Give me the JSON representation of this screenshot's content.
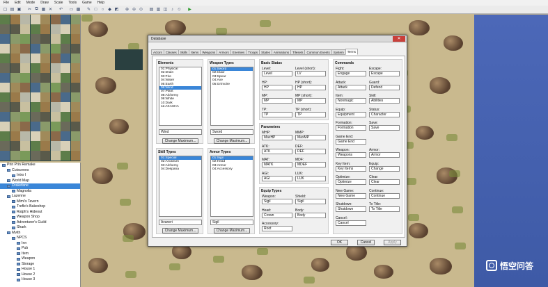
{
  "menubar": [
    "File",
    "Edit",
    "Mode",
    "Draw",
    "Scale",
    "Tools",
    "Game",
    "Help"
  ],
  "tree": [
    {
      "label": "Prin Prin Remake",
      "indent": 0,
      "selected": false
    },
    {
      "label": "Cutscenes",
      "indent": 1,
      "selected": false
    },
    {
      "label": "Intro I",
      "indent": 2,
      "selected": false
    },
    {
      "label": "World Map",
      "indent": 1,
      "selected": false
    },
    {
      "label": "Drakefane",
      "indent": 1,
      "selected": true
    },
    {
      "label": "Magnolia",
      "indent": 2,
      "selected": false
    },
    {
      "label": "Lazenne",
      "indent": 1,
      "selected": false
    },
    {
      "label": "Mimi's Tavern",
      "indent": 2,
      "selected": false
    },
    {
      "label": "Trefle's Bakeshop",
      "indent": 2,
      "selected": false
    },
    {
      "label": "Ralph's Hideout",
      "indent": 2,
      "selected": false
    },
    {
      "label": "Weapon Shop",
      "indent": 2,
      "selected": false
    },
    {
      "label": "Adventurer's Guild",
      "indent": 2,
      "selected": false
    },
    {
      "label": "Shark",
      "indent": 2,
      "selected": false
    },
    {
      "label": "Mvith",
      "indent": 1,
      "selected": false
    },
    {
      "label": "NPCS",
      "indent": 2,
      "selected": false
    },
    {
      "label": "Inn",
      "indent": 3,
      "selected": false
    },
    {
      "label": "Pub",
      "indent": 3,
      "selected": false
    },
    {
      "label": "Item",
      "indent": 3,
      "selected": false
    },
    {
      "label": "Weapon",
      "indent": 3,
      "selected": false
    },
    {
      "label": "Storage",
      "indent": 3,
      "selected": false
    },
    {
      "label": "House 1",
      "indent": 3,
      "selected": false
    },
    {
      "label": "House 2",
      "indent": 3,
      "selected": false
    },
    {
      "label": "House 3",
      "indent": 3,
      "selected": false
    }
  ],
  "dialog": {
    "title": "Database",
    "close_glyph": "✕",
    "tabs": [
      "Actors",
      "Classes",
      "Skills",
      "Items",
      "Weapons",
      "Armors",
      "Enemies",
      "Troops",
      "States",
      "Animations",
      "Tilesets",
      "Common Events",
      "System",
      "Terms"
    ],
    "active_tab": "Terms",
    "elements": {
      "title": "Elements",
      "items": [
        "01:Physical",
        "02:Drain",
        "03:Fire",
        "04:Water",
        "05:Earth",
        "06:Wind",
        "07:Plant",
        "08:Alchemy",
        "09:White",
        "10:Dark",
        "11:AKASHA"
      ],
      "selected": 5,
      "name": "Wind",
      "btn": "Change Maximum..."
    },
    "weapon_types": {
      "title": "Weapon Types",
      "items": [
        "01:Sword",
        "02:Claw",
        "03:Spear",
        "04:Axe",
        "05:Grimoire"
      ],
      "selected": 0,
      "name": "Sword",
      "btn": "Change Maximum..."
    },
    "skill_types": {
      "title": "Skill Types",
      "items": [
        "01:Special",
        "02:Arcanum",
        "03:Alchemy",
        "04:Despana"
      ],
      "selected": 0,
      "name": "Avaneri",
      "btn": "Change Maximum..."
    },
    "armor_types": {
      "title": "Armor Types",
      "items": [
        "01:Sigil",
        "02:Head",
        "03:Armor",
        "04:Accessory"
      ],
      "selected": 0,
      "name": "Sigil",
      "btn": "Change Maximum..."
    },
    "basic_status": {
      "title": "Basic Status",
      "fields": [
        {
          "l1": "Level:",
          "v1": "Level",
          "l2": "Level (short):",
          "v2": "LV"
        },
        {
          "l1": "HP:",
          "v1": "HP",
          "l2": "HP (short):",
          "v2": "HP"
        },
        {
          "l1": "MP:",
          "v1": "MP",
          "l2": "MP (short):",
          "v2": "MP"
        },
        {
          "l1": "TP:",
          "v1": "TP",
          "l2": "TP (short):",
          "v2": "TP"
        }
      ]
    },
    "parameters": {
      "title": "Parameters",
      "fields": [
        {
          "l1": "MHP:",
          "v1": "MaxHP",
          "l2": "MMP:",
          "v2": "MaxMP"
        },
        {
          "l1": "ATK:",
          "v1": "ATK",
          "l2": "DEF:",
          "v2": "DEF"
        },
        {
          "l1": "MAT:",
          "v1": "MATK",
          "l2": "MDF:",
          "v2": "MDEF"
        },
        {
          "l1": "AGI:",
          "v1": "AGI",
          "l2": "LUK:",
          "v2": "LUK"
        }
      ]
    },
    "equip_types": {
      "title": "Equip Types",
      "fields": [
        {
          "l1": "Weapon:",
          "v1": "Sigil",
          "l2": "Shield:",
          "v2": "Sigil"
        },
        {
          "l1": "Head:",
          "v1": "Crown",
          "l2": "Body:",
          "v2": "Body"
        },
        {
          "l1": "Accessory:",
          "v1": "Root",
          "l2": "",
          "v2": ""
        }
      ]
    },
    "commands": {
      "title": "Commands",
      "fields": [
        {
          "l1": "Fight:",
          "v1": "Engage",
          "l2": "Escape:",
          "v2": "Escape"
        },
        {
          "l1": "Attack:",
          "v1": "Attack",
          "l2": "Guard:",
          "v2": "Defend"
        },
        {
          "l1": "Item:",
          "v1": "Nonmagic",
          "l2": "Skill:",
          "v2": "Abilities"
        },
        {
          "l1": "Equip:",
          "v1": "Equipment",
          "l2": "Status:",
          "v2": "Character"
        },
        {
          "l1": "Formation:",
          "v1": "Formation",
          "l2": "Save:",
          "v2": "Save"
        },
        {
          "l1": "Game End:",
          "v1": "Game End",
          "l2": "",
          "v2": ""
        },
        {
          "l1": "Weapon:",
          "v1": "Weapons",
          "l2": "Armor:",
          "v2": "Armor"
        },
        {
          "l1": "Key Item:",
          "v1": "Key Items",
          "l2": "Equip:",
          "v2": "Change"
        },
        {
          "l1": "Optimize:",
          "v1": "Optimize",
          "l2": "Clear:",
          "v2": "Clear"
        },
        {
          "l1": "New Game:",
          "v1": "New Game",
          "l2": "Continue:",
          "v2": "Continue"
        },
        {
          "l1": "Shutdown:",
          "v1": "Shutdown",
          "l2": "To Title:",
          "v2": "To Title"
        },
        {
          "l1": "Cancel:",
          "v1": "Cancel",
          "l2": "",
          "v2": ""
        }
      ]
    },
    "buttons": {
      "ok": "OK",
      "cancel": "Cancel",
      "apply": "Apply"
    }
  },
  "watermark": {
    "text": "悟空问答"
  }
}
